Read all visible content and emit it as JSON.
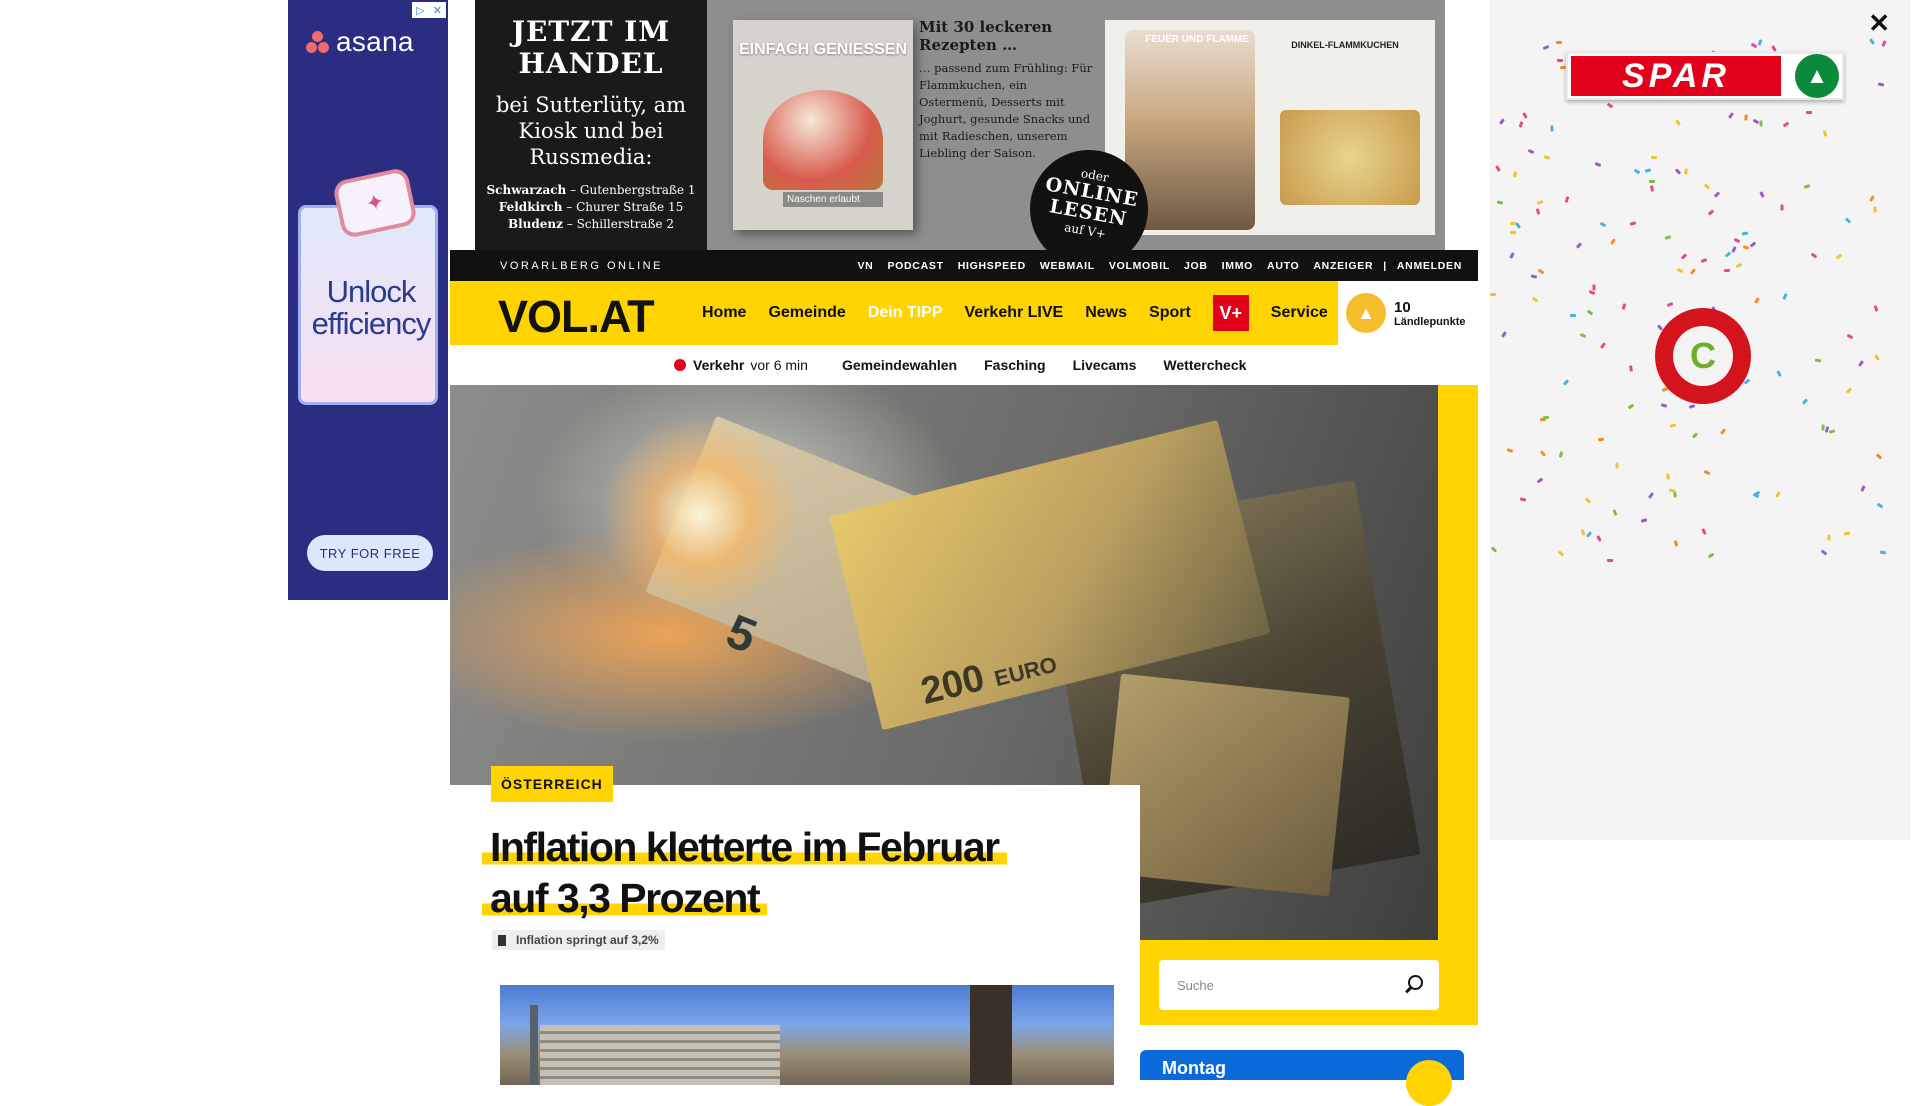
{
  "asana_ad": {
    "brand": "asana",
    "headline": "Unlock efficiency",
    "cta": "TRY FOR FREE",
    "adchoices_icons": [
      "adchoices-icon",
      "close-icon"
    ],
    "colors": {
      "background": "#2b2d82",
      "logo_dots": "#f06a6a"
    }
  },
  "top_banner": {
    "headline": "JETZT IM HANDEL",
    "subheadline": "bei Sutterlüty, am Kiosk und bei Russmedia:",
    "addresses": [
      {
        "city": "Schwarzach",
        "street": "Gutenbergstraße 1"
      },
      {
        "city": "Feldkirch",
        "street": "Churer Straße 15"
      },
      {
        "city": "Bludenz",
        "street": "Schillerstraße 2"
      }
    ],
    "magazine_title": "EINFACH GENIESSEN",
    "magazine_subtitle": "Naschen erlaubt",
    "recipes_heading": "Mit 30 leckeren Rezepten …",
    "recipes_text": "… passend zum Frühling: Für Flammkuchen, ein Ostermenü, Desserts mit Joghurt, gesunde Snacks und mit Radieschen, unserem Liebling der Saison.",
    "page_heading_left": "FEUER UND FLAMME",
    "page_heading_right": "DINKEL-FLAMMKUCHEN",
    "badge": {
      "top": "oder",
      "main": "ONLINE LESEN",
      "bottom": "auf V+"
    }
  },
  "top_nav": {
    "site_name": "VORARLBERG ONLINE",
    "links": [
      "VN",
      "PODCAST",
      "HIGHSPEED",
      "WEBMAIL",
      "VOLMOBIL",
      "JOB",
      "IMMO",
      "AUTO",
      "ANZEIGER"
    ],
    "separator": "|",
    "login": "ANMELDEN"
  },
  "main_nav": {
    "logo": "VOL.AT",
    "items": [
      "Home",
      "Gemeinde",
      "Dein TIPP",
      "Verkehr LIVE",
      "News",
      "Sport"
    ],
    "vplus": "V+",
    "service": "Service",
    "points_value": "10",
    "points_label": "Ländlepunkte"
  },
  "sub_nav": {
    "live_label": "Verkehr",
    "live_time": "vor 6 min",
    "links": [
      "Gemeindewahlen",
      "Fasching",
      "Livecams",
      "Wettercheck"
    ]
  },
  "hero": {
    "note_text_5": "5",
    "note_text_200": "200",
    "note_text_euro": "EURO"
  },
  "article": {
    "category": "ÖSTERREICH",
    "title_line1": "Inflation kletterte im Februar",
    "title_line2": "auf 3,3 Prozent",
    "related": "Inflation springt auf 3,2%"
  },
  "sidebar": {
    "search_placeholder": "Suche",
    "weather_day": "Montag"
  },
  "spar_ad": {
    "brand": "SPAR",
    "close": "✕",
    "badge_letter": "C"
  },
  "colors": {
    "vol_yellow": "#ffd400",
    "vplus_red": "#e3001b",
    "spar_red": "#e2001a",
    "spar_green": "#0a8a3a",
    "weather_blue": "#0a6ad9"
  }
}
